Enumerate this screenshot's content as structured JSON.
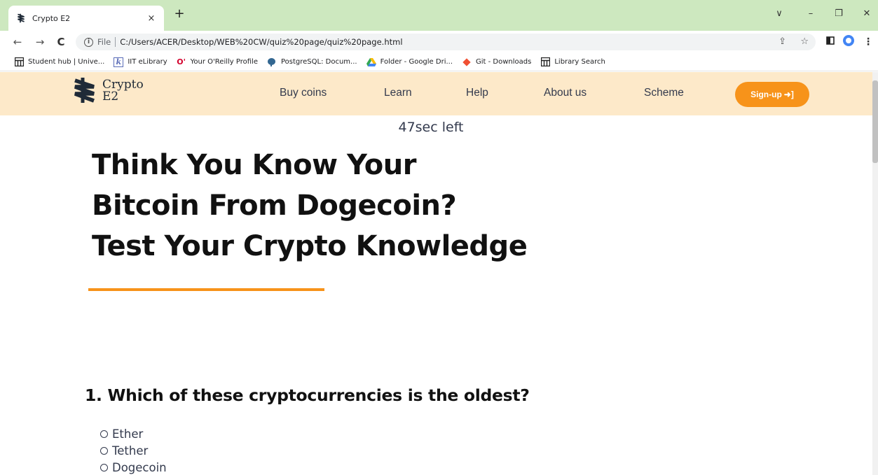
{
  "browser": {
    "tab_title": "Crypto E2",
    "tab_close": "×",
    "new_tab": "+",
    "url_scheme": "File",
    "url": "C:/Users/ACER/Desktop/WEB%20CW/quiz%20page/quiz%20page.html",
    "window_controls": {
      "dropdown": "∨",
      "minimize": "–",
      "restore": "❐",
      "close": "✕"
    }
  },
  "bookmarks": [
    {
      "label": "Student hub | Unive...",
      "icon": "grid-icon"
    },
    {
      "label": "IIT eLibrary",
      "icon": "k-icon"
    },
    {
      "label": "Your O'Reilly Profile",
      "icon": "oreilly-icon"
    },
    {
      "label": "PostgreSQL: Docum...",
      "icon": "elephant-icon"
    },
    {
      "label": "Folder - Google Dri...",
      "icon": "drive-icon"
    },
    {
      "label": "Git - Downloads",
      "icon": "git-icon"
    },
    {
      "label": "Library Search",
      "icon": "grid-icon"
    }
  ],
  "site": {
    "logo_line1": "Crypto",
    "logo_line2": "E2",
    "nav": [
      "Buy coins",
      "Learn",
      "Help",
      "About us",
      "Scheme"
    ],
    "signup_label": "Sign-up",
    "signup_icon": "login-icon"
  },
  "quiz": {
    "timer": "47sec left",
    "heading_lines": [
      "Think You Know Your",
      "Bitcoin From Dogecoin?",
      "Test Your Crypto Knowledge"
    ],
    "question": "1. Which of these cryptocurrencies is the oldest?",
    "options": [
      "Ether",
      "Tether",
      "Dogecoin"
    ]
  },
  "colors": {
    "tabstrip": "#cde8bf",
    "site_nav": "#fde9c9",
    "accent": "#f7931a",
    "text_dark": "#111111"
  }
}
